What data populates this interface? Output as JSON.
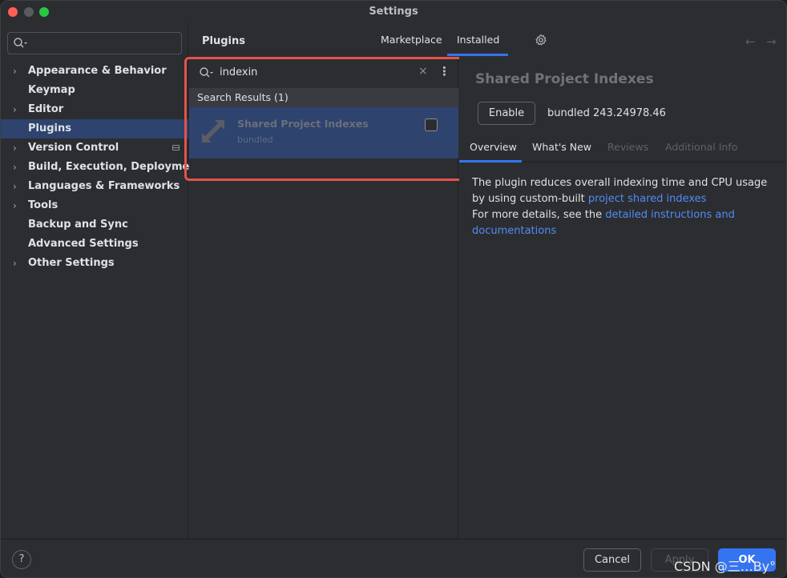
{
  "window": {
    "title": "Settings"
  },
  "sidebar": {
    "search_placeholder": "",
    "items": [
      {
        "label": "Appearance & Behavior",
        "expandable": true
      },
      {
        "label": "Keymap",
        "expandable": false
      },
      {
        "label": "Editor",
        "expandable": true
      },
      {
        "label": "Plugins",
        "expandable": false,
        "selected": true
      },
      {
        "label": "Version Control",
        "expandable": true,
        "badge": "project-icon"
      },
      {
        "label": "Build, Execution, Deployment",
        "expandable": true
      },
      {
        "label": "Languages & Frameworks",
        "expandable": true
      },
      {
        "label": "Tools",
        "expandable": true
      },
      {
        "label": "Backup and Sync",
        "expandable": false
      },
      {
        "label": "Advanced Settings",
        "expandable": false
      },
      {
        "label": "Other Settings",
        "expandable": true
      }
    ]
  },
  "header": {
    "title": "Plugins",
    "tabs": {
      "marketplace": "Marketplace",
      "installed": "Installed"
    },
    "active_tab": "Installed"
  },
  "plugin_search": {
    "query": "indexin",
    "clear_glyph": "×",
    "more_glyph": "⋮",
    "results_header": "Search Results (1)",
    "results": [
      {
        "name": "Shared Project Indexes",
        "subtitle": "bundled",
        "enabled": false
      }
    ]
  },
  "detail": {
    "title": "Shared Project Indexes",
    "enable_label": "Enable",
    "version": "bundled 243.24978.46",
    "tabs": {
      "overview": "Overview",
      "whats_new": "What's New",
      "reviews": "Reviews",
      "additional_info": "Additional Info"
    },
    "active_tab": "Overview",
    "description": {
      "line1_text": "The plugin reduces overall indexing time and CPU usage by using custom-built ",
      "line1_link": "project shared indexes",
      "line2_text": "For more details, see the ",
      "line2_link": "detailed instructions and documentations"
    }
  },
  "footer": {
    "help_glyph": "?",
    "cancel_label": "Cancel",
    "apply_label": "Apply",
    "ok_label": "OK",
    "watermark": "CSDN @三…By°"
  },
  "colors": {
    "accent": "#3574f0",
    "selection": "#2e436e",
    "highlight_box": "#e3524a",
    "link": "#548af7"
  }
}
